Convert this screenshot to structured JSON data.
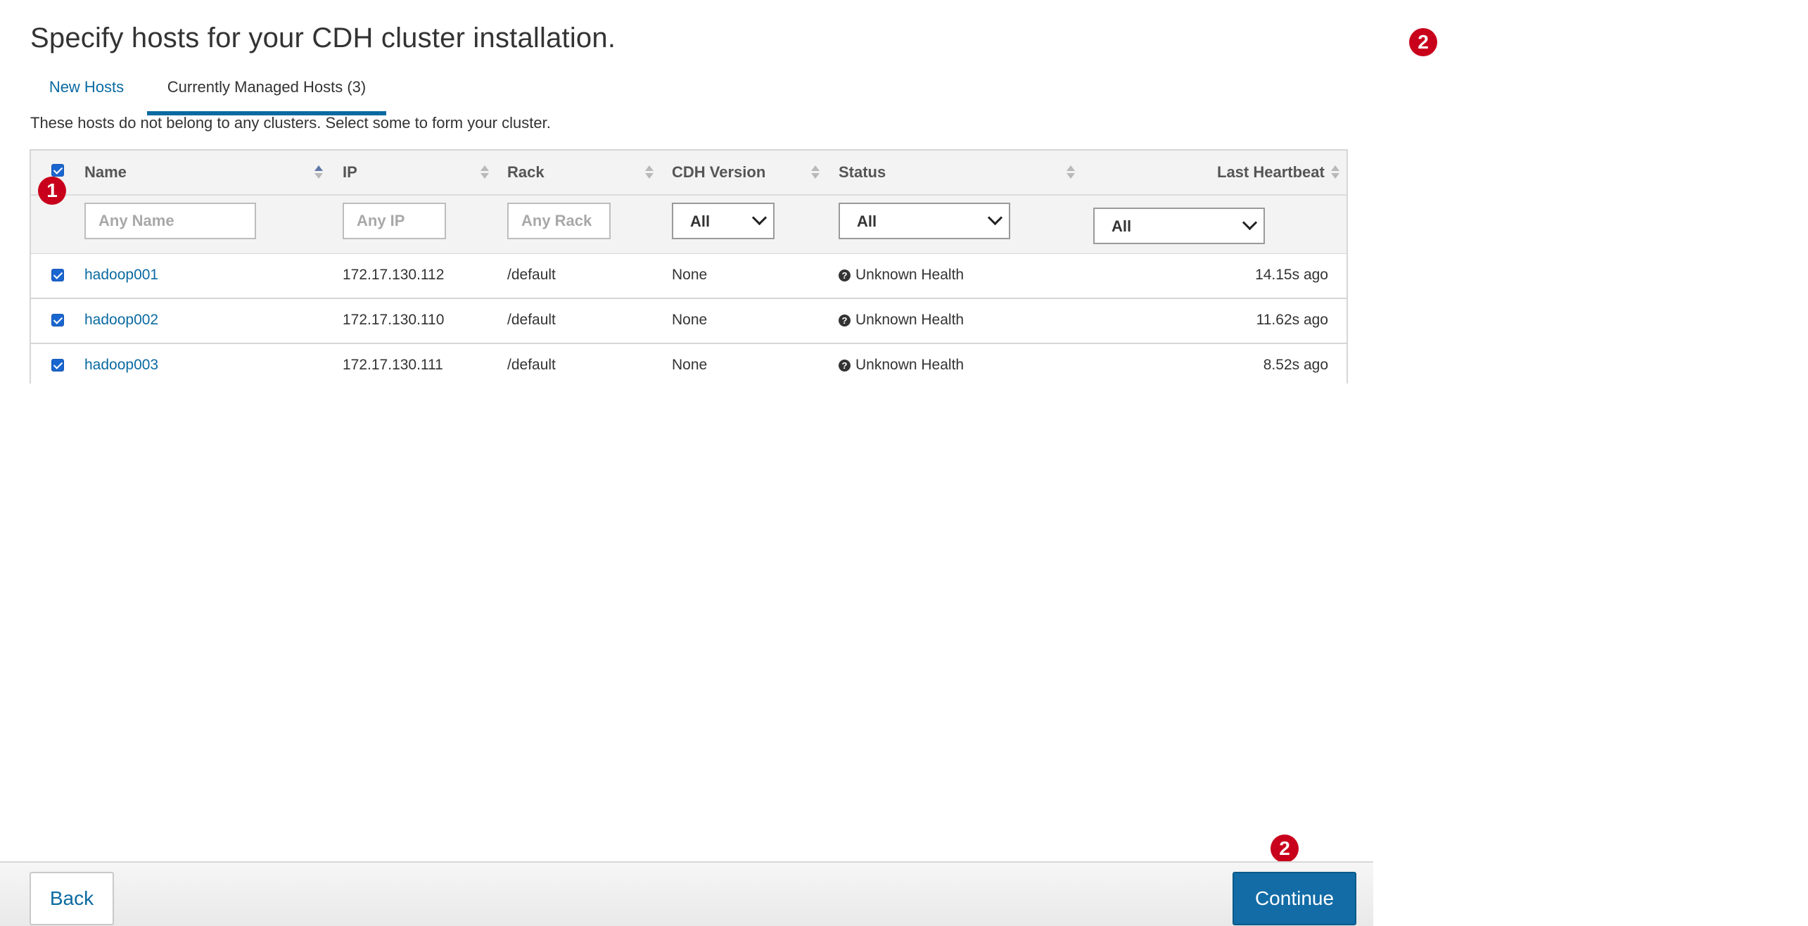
{
  "page": {
    "title": "Specify hosts for your CDH cluster installation.",
    "intro": "These hosts do not belong to any clusters. Select some to form your cluster."
  },
  "tabs": [
    {
      "label": "New Hosts",
      "active": false
    },
    {
      "label": "Currently Managed Hosts (3)",
      "active": true
    }
  ],
  "table": {
    "columns": [
      "Name",
      "IP",
      "Rack",
      "CDH Version",
      "Status",
      "Last Heartbeat"
    ],
    "sorted_column": "Name",
    "select_all_checked": true,
    "filters": {
      "name_placeholder": "Any Name",
      "ip_placeholder": "Any IP",
      "rack_placeholder": "Any Rack",
      "cdh_version": "All",
      "status": "All",
      "last_heartbeat": "All"
    },
    "rows": [
      {
        "checked": true,
        "name": "hadoop001",
        "ip": "172.17.130.112",
        "rack": "/default",
        "cdh": "None",
        "status": "Unknown Health",
        "heartbeat": "14.15s ago"
      },
      {
        "checked": true,
        "name": "hadoop002",
        "ip": "172.17.130.110",
        "rack": "/default",
        "cdh": "None",
        "status": "Unknown Health",
        "heartbeat": "11.62s ago"
      },
      {
        "checked": true,
        "name": "hadoop003",
        "ip": "172.17.130.111",
        "rack": "/default",
        "cdh": "None",
        "status": "Unknown Health",
        "heartbeat": "8.52s ago"
      }
    ]
  },
  "badges": [
    "1",
    "2",
    "2"
  ],
  "footer": {
    "back_label": "Back",
    "continue_label": "Continue"
  },
  "icons": {
    "status": "question-circle-icon",
    "sort": "sort-arrows-icon",
    "dropdown": "chevron-down-icon"
  },
  "colors": {
    "link": "#0a6aa1",
    "primary_button": "#136ca6",
    "badge": "#c8001b",
    "checkbox": "#1a66d0"
  }
}
